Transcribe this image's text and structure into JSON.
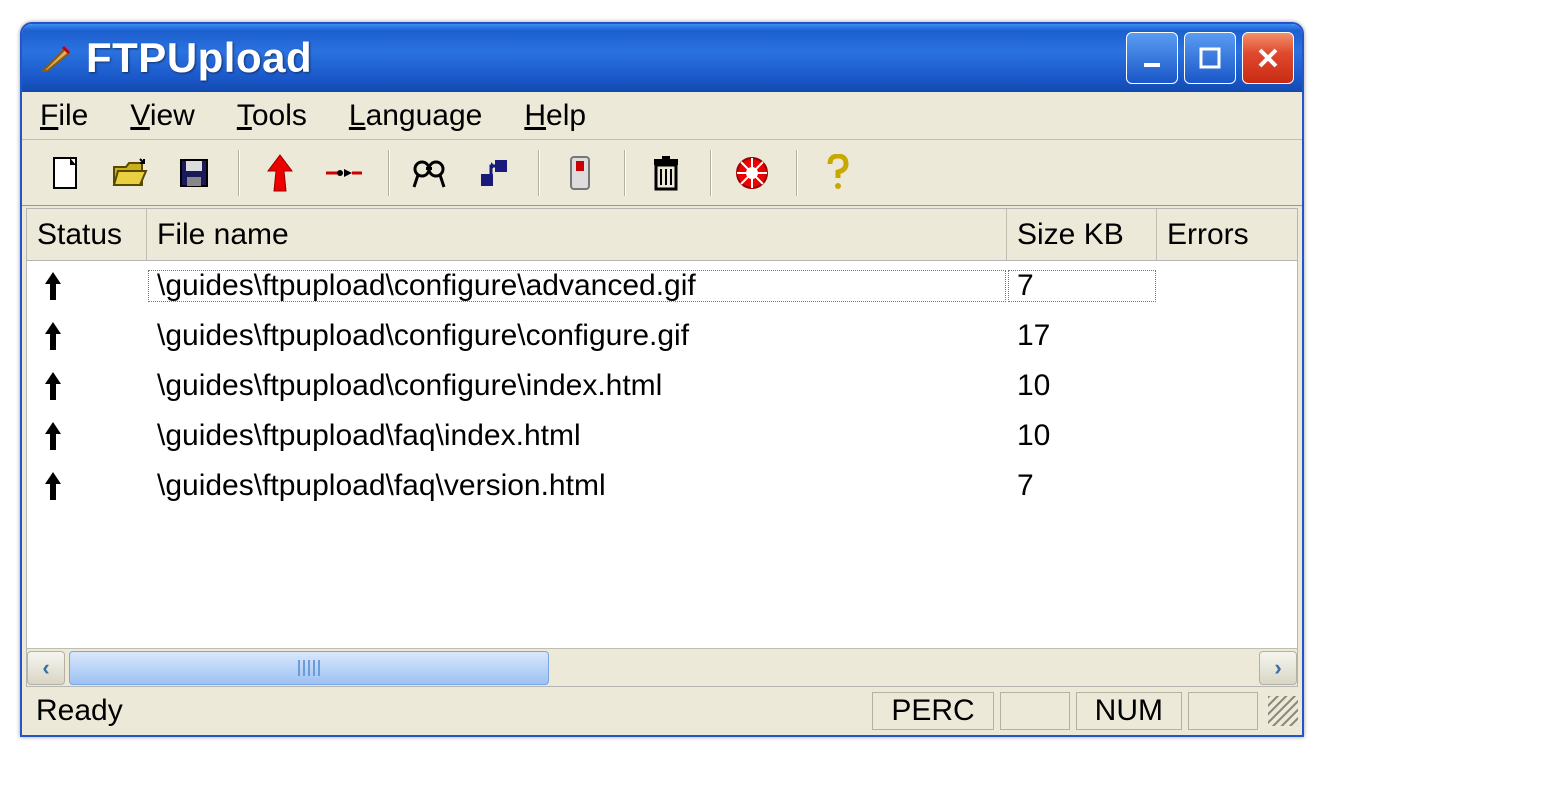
{
  "window": {
    "title": "FTPUpload"
  },
  "menu": {
    "file": "File",
    "view": "View",
    "tools": "Tools",
    "language": "Language",
    "help": "Help"
  },
  "toolbar": {
    "icons": [
      "new",
      "open",
      "save",
      "upload",
      "connect",
      "find",
      "path",
      "options",
      "delete",
      "stop",
      "help"
    ]
  },
  "columns": {
    "status": "Status",
    "filename": "File name",
    "size": "Size KB",
    "errors": "Errors"
  },
  "rows": [
    {
      "status": "up",
      "filename": "\\guides\\ftpupload\\configure\\advanced.gif",
      "size": "7",
      "errors": ""
    },
    {
      "status": "up",
      "filename": "\\guides\\ftpupload\\configure\\configure.gif",
      "size": "17",
      "errors": ""
    },
    {
      "status": "up",
      "filename": "\\guides\\ftpupload\\configure\\index.html",
      "size": "10",
      "errors": ""
    },
    {
      "status": "up",
      "filename": "\\guides\\ftpupload\\faq\\index.html",
      "size": "10",
      "errors": ""
    },
    {
      "status": "up",
      "filename": "\\guides\\ftpupload\\faq\\version.html",
      "size": "7",
      "errors": ""
    }
  ],
  "statusbar": {
    "ready": "Ready",
    "panes": [
      "PERC",
      "",
      "NUM",
      ""
    ]
  }
}
